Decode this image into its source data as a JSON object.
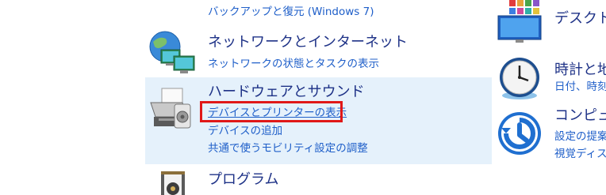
{
  "left_column": {
    "backup_link": "バックアップと復元 (Windows 7)",
    "network": {
      "title": "ネットワークとインターネット",
      "links": [
        "ネットワークの状態とタスクの表示"
      ]
    },
    "hardware": {
      "title": "ハードウェアとサウンド",
      "links": [
        "デバイスとプリンターの表示",
        "デバイスの追加",
        "共通で使うモビリティ設定の調整"
      ]
    },
    "programs": {
      "title": "プログラム"
    }
  },
  "right_column": {
    "desktop": {
      "title": "デスクトッ"
    },
    "clock": {
      "title": "時計と地",
      "links": [
        "日付、時刻"
      ]
    },
    "access": {
      "title": "コンピュー",
      "links": [
        "設定の提案",
        "視覚ディス"
      ]
    }
  },
  "colors": {
    "hover_panel": "#e5f1fb",
    "highlight_border": "#e01818",
    "category_title": "#1e3287",
    "link": "#1f5fc9"
  },
  "icons": [
    "network-globe-icon",
    "printer-icon",
    "programs-icon",
    "desktop-icon",
    "clock-icon",
    "ease-of-access-icon"
  ]
}
